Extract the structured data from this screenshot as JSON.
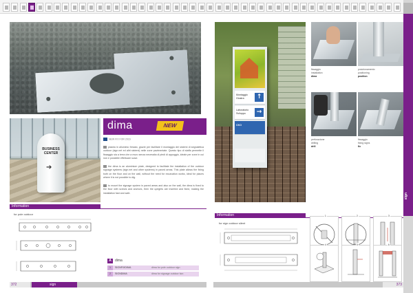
{
  "thumbnails": {
    "count": 47,
    "active_index": 3
  },
  "left_page": {
    "product_title": "dima",
    "new_badge": "NEW",
    "subline": "NEW FIX FOR 2016",
    "paragraphs": [
      "piastra in alluminio fresato, grazie per facilitare il montaggio dei sistemi di segnaletica outdoor (sign.net ed altri sistemi) nelle zone pavimentate. Questo tipo di staffa permette il fissaggio sia a terra che a muro senza necessita di piedi di appoggio, ideale per zone in cui non e possibile effettuare scavi.",
      "the dima is an aluminium plate, designed to facilitate the installation of the outdoor signage systems (sign.net and other systems) in paved areas. This plate allows the fixing both on the floor and on the wall, without the need for excavation works, ideal for places where it is not possible to dig.",
      "to mount the signage system in paved areas and also on the wall, the dima is fixed to the floor with screws and anchors, then the uprights are inserted and fixed, making the installation fast and safe."
    ],
    "info_label": "Information",
    "drawing_caption": "for pole outdoor",
    "article_tag": "A",
    "article_title": "dima",
    "articles": [
      {
        "num": "1",
        "code": "SIGNFIXDIMA",
        "desc": "dima for pole outdoor sign"
      },
      {
        "num": "2",
        "code": "SIGNDIMA",
        "desc": "dima for signage outdoor two"
      }
    ],
    "page_number": "372",
    "section": "sign",
    "pylon_text": "BUSINESS CENTER"
  },
  "right_page": {
    "info_label": "Information",
    "drawing_caption": "for sign outdoor silent",
    "captions": [
      {
        "it": "fissaggio",
        "en": "installation",
        "step": "dima"
      },
      {
        "it": "posizionamento",
        "en": "positioning",
        "step": "position"
      },
      {
        "it": "perforazione",
        "en": "drilling",
        "step": "drill"
      },
      {
        "it": "fissaggio",
        "en": "fixing signs",
        "step": "fix"
      }
    ],
    "totem_rows": [
      "Montaggio Giostra",
      "Laboratorio Sviluppo",
      "CKO"
    ],
    "page_number": "373",
    "side_tab": "sign",
    "diagram_labels": [
      "1",
      "2",
      "3",
      "4",
      "5",
      "6"
    ]
  },
  "colors": {
    "accent": "#7a1f8a",
    "badge": "#f2c21b",
    "sign_blue": "#2f66b0"
  },
  "icons": [
    "catalog-thumbnail-icon",
    "arrow-right-icon",
    "company-logo-icon"
  ]
}
